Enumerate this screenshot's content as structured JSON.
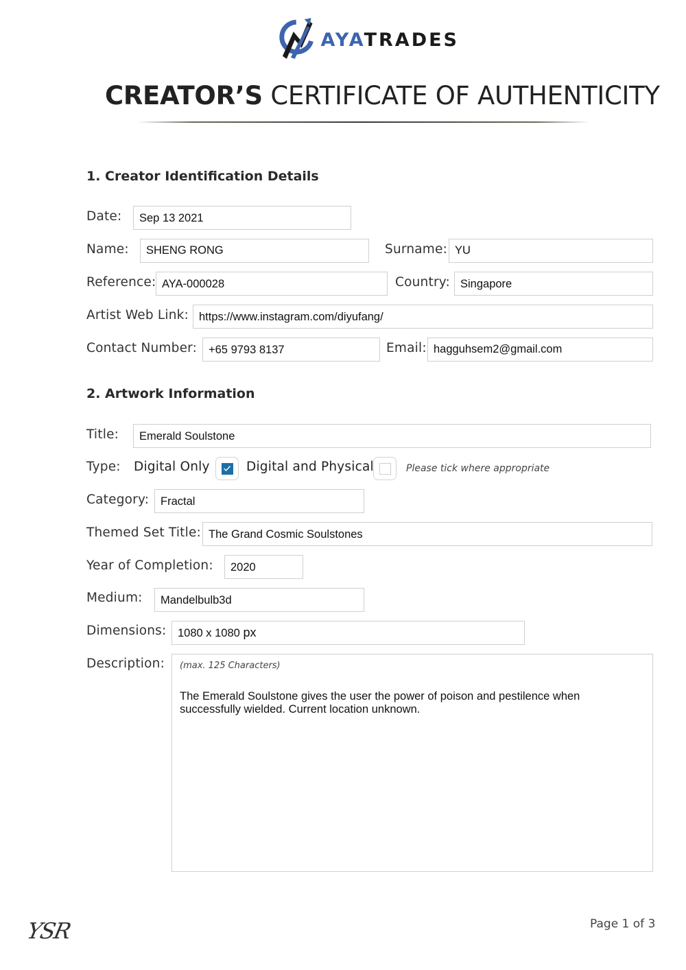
{
  "brand": {
    "name_part1": "AYA",
    "name_part2": "TRADES",
    "logo_icon": "aya-arrow-logo-icon",
    "colors": {
      "accent": "#3e64ad",
      "dark": "#1a1a1a"
    }
  },
  "document": {
    "title_bold": "CREATOR’S",
    "title_light": "CERTIFICATE OF AUTHENTICITY"
  },
  "section1": {
    "heading": "1. Creator Identification Details",
    "date_label": "Date:",
    "date_value": "Sep 13 2021",
    "name_label": "Name:",
    "name_value": "SHENG RONG",
    "surname_label": "Surname:",
    "surname_value": "YU",
    "reference_label": "Reference:",
    "reference_value": "AYA-000028",
    "country_label": "Country:",
    "country_value": "Singapore",
    "weblink_label": "Artist Web Link:",
    "weblink_value": "https://www.instagram.com/diyufang/",
    "contact_label": "Contact Number:",
    "contact_value": "+65 9793 8137",
    "email_label": "Email:",
    "email_value": "hagguhsem2@gmail.com"
  },
  "section2": {
    "heading": "2. Artwork Information",
    "title_label": "Title:",
    "title_value": "Emerald Soulstone",
    "type_label": "Type:",
    "type_options": [
      {
        "label": "Digital Only",
        "checked": true
      },
      {
        "label": "Digital and Physical",
        "checked": false
      }
    ],
    "type_hint": "Please tick where appropriate",
    "category_label": "Category:",
    "category_value": "Fractal",
    "themed_set_label": "Themed Set Title:",
    "themed_set_value": "The Grand Cosmic Soulstones",
    "year_label": "Year of Completion:",
    "year_value": "2020",
    "medium_label": "Medium:",
    "medium_value": "Mandelbulb3d",
    "dimensions_label": "Dimensions:",
    "dimensions_value": "1080 x 1080",
    "dimensions_unit": "px",
    "description_label": "Description:",
    "description_hint": "(max. 125 Characters)",
    "description_value": "The Emerald Soulstone gives the user the power of poison and pestilence when successfully wielded. Current location unknown."
  },
  "footer": {
    "signature": "YSR",
    "page_label": "Page 1 of 3"
  }
}
